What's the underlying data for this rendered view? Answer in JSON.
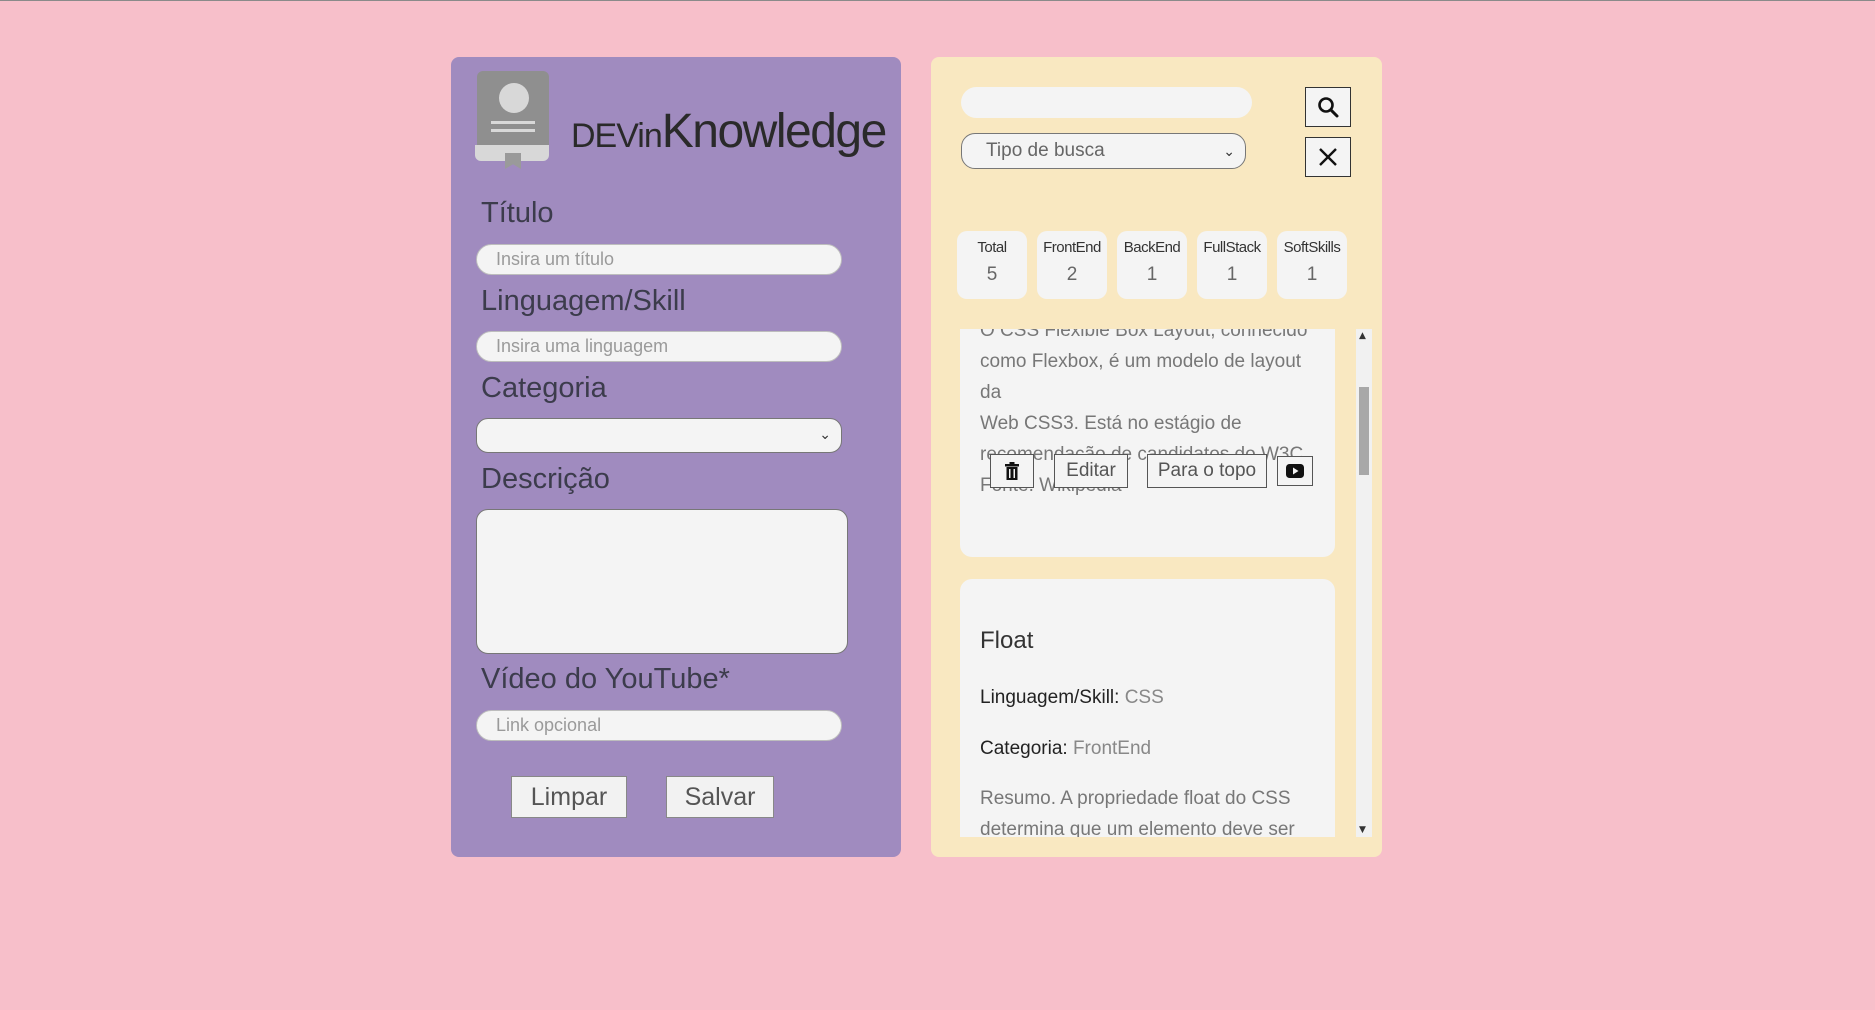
{
  "brand": {
    "prefix": "DEVin",
    "name": "Knowledge"
  },
  "form": {
    "title_label": "Título",
    "title_placeholder": "Insira um título",
    "language_label": "Linguagem/Skill",
    "language_placeholder": "Insira uma linguagem",
    "category_label": "Categoria",
    "category_value": "",
    "description_label": "Descrição",
    "video_label": "Vídeo do YouTube*",
    "video_placeholder": "Link opcional",
    "clear_label": "Limpar",
    "save_label": "Salvar"
  },
  "search": {
    "query": "",
    "type_placeholder": "Tipo de busca"
  },
  "stats": [
    {
      "name": "Total",
      "value": "5"
    },
    {
      "name": "FrontEnd",
      "value": "2"
    },
    {
      "name": "BackEnd",
      "value": "1"
    },
    {
      "name": "FullStack",
      "value": "1"
    },
    {
      "name": "SoftSkills",
      "value": "1"
    }
  ],
  "cards": [
    {
      "description_lines": [
        "O CSS Flexible Box Layout, conhecido",
        "como Flexbox, é um modelo de layout da",
        "Web CSS3. Está no estágio de",
        "recomendação de candidatos do W3C.",
        "Fonte: Wikipedia"
      ],
      "edit_label": "Editar",
      "top_label": "Para o topo"
    },
    {
      "title": "Float",
      "language_key": "Linguagem/Skill:",
      "language_value": "CSS",
      "category_key": "Categoria:",
      "category_value": "FrontEnd",
      "description_lines": [
        "Resumo. A propriedade float do CSS",
        "determina que um elemento deve ser"
      ]
    }
  ],
  "colors": {
    "background": "#f7bfca",
    "form_panel": "#a08bbf",
    "list_panel": "#f9e8c1"
  }
}
